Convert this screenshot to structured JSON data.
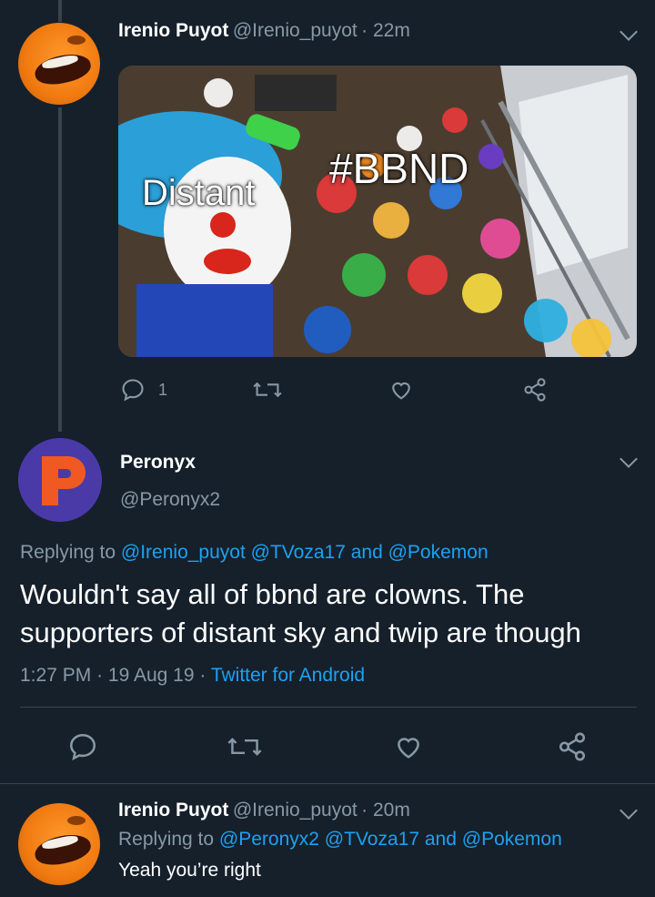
{
  "tweet1": {
    "name": "Irenio Puyot",
    "handle": "@Irenio_puyot",
    "dot_time": "· 22m",
    "image_labels": {
      "left": "Distant",
      "right": "#BBND"
    },
    "reply_count": "1"
  },
  "tweet2": {
    "name": "Peronyx",
    "handle": "@Peronyx2",
    "replying_prefix": "Replying to",
    "replying_to": [
      "@Irenio_puyot",
      "@TVoza17"
    ],
    "and": "and",
    "replying_last": "@Pokemon",
    "text": "Wouldn't say all of bbnd are clowns. The supporters of distant sky and twip are though",
    "time": "1:27 PM",
    "date": "19 Aug 19",
    "source": "Twitter for Android",
    "sep": "·"
  },
  "tweet3": {
    "name": "Irenio Puyot",
    "handle": "@Irenio_puyot",
    "dot_time": "· 20m",
    "replying_prefix": "Replying to",
    "replying_to": [
      "@Peronyx2",
      "@TVoza17"
    ],
    "and": "and",
    "replying_last": "@Pokemon",
    "text": "Yeah you’re right"
  },
  "colors": {
    "background": "#15202b",
    "accent": "#1da1f2",
    "muted": "#8899a6",
    "divider": "#38444d",
    "avatar_p_bg": "#4a3aa8",
    "avatar_p_fg": "#f05a22"
  },
  "icons": [
    "reply-icon",
    "retweet-icon",
    "like-icon",
    "share-icon",
    "chevron-down-icon"
  ]
}
